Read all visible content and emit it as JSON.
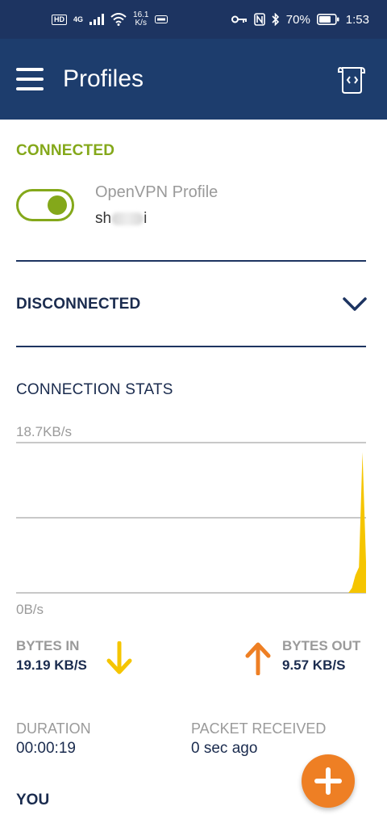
{
  "status_bar": {
    "hd": "HD",
    "network": "4G",
    "speed_value": "16.1",
    "speed_unit": "K/s",
    "battery": "70%",
    "time": "1:53"
  },
  "app_bar": {
    "title": "Profiles"
  },
  "connected": {
    "label": "CONNECTED",
    "profile_type": "OpenVPN Profile",
    "profile_name_start": "sh",
    "profile_name_end": "i",
    "toggle_on": true
  },
  "disconnected": {
    "label": "DISCONNECTED"
  },
  "stats": {
    "label": "CONNECTION STATS",
    "chart_data": {
      "type": "area",
      "y_max_label": "18.7KB/s",
      "y_min_label": "0B/s",
      "ylim": [
        0,
        18.7
      ],
      "y_unit": "KB/s",
      "grid": true,
      "series": [
        {
          "color": "#f5c500",
          "values": [
            0,
            0,
            0,
            0,
            0,
            0,
            0,
            0,
            0,
            0,
            0,
            0,
            0,
            0,
            0,
            0,
            0,
            0,
            0,
            0,
            0,
            0,
            0,
            0,
            0,
            0,
            0,
            0,
            0,
            0,
            0,
            0,
            0,
            0,
            0,
            0,
            0,
            0,
            0,
            0,
            0,
            0,
            0,
            0,
            0,
            0,
            0,
            0,
            0,
            0,
            0,
            0,
            0,
            0,
            0,
            0,
            0,
            0,
            0,
            0,
            0,
            0,
            0,
            0,
            0,
            0,
            0,
            0,
            0,
            0,
            0,
            0,
            0,
            0,
            0,
            0,
            0,
            0,
            0,
            0,
            0,
            0,
            0,
            0,
            0,
            0,
            0,
            0,
            0,
            0,
            0,
            0,
            0,
            0,
            0,
            0.6,
            2.2,
            3.2,
            17.5,
            3.8
          ]
        }
      ]
    },
    "bytes_in_label": "BYTES IN",
    "bytes_in_value": "19.19 KB/S",
    "bytes_in_color": "#f5c500",
    "bytes_out_label": "BYTES OUT",
    "bytes_out_value": "9.57 KB/S",
    "bytes_out_color": "#ee7f24",
    "duration_label": "DURATION",
    "duration_value": "00:00:19",
    "packet_label": "PACKET RECEIVED",
    "packet_value": "0 sec ago"
  },
  "you": {
    "label": "YOU"
  },
  "colors": {
    "appbar": "#1d3d6d",
    "accent_green": "#84a81a",
    "fab": "#ee7f24"
  },
  "icons": {
    "menu": "hamburger-menu-icon",
    "import": "import-profile-icon",
    "chevron": "chevron-down-icon",
    "fab": "plus-icon"
  }
}
